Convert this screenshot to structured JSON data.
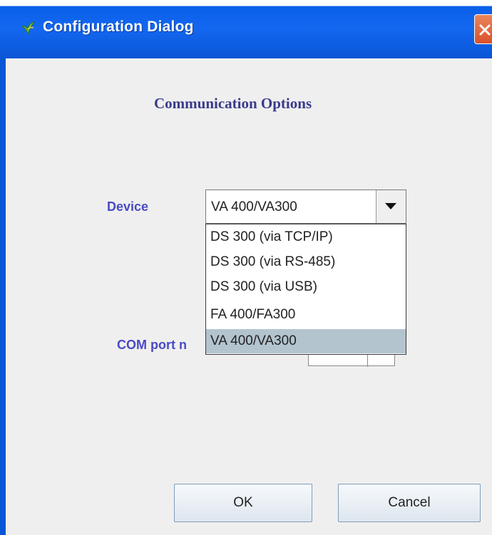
{
  "window": {
    "title": "Configuration Dialog",
    "app_icon": "leaf-icon",
    "close_icon": "close-icon"
  },
  "heading": "Communication Options",
  "device": {
    "label": "Device",
    "selected": "VA 400/VA300",
    "arrow_icon": "chevron-down-icon",
    "options": [
      "DS 300 (via TCP/IP)",
      "DS 300 (via RS-485)",
      "DS 300 (via USB)",
      "FA 400/FA300",
      "VA 400/VA300"
    ],
    "highlighted_index": 4
  },
  "com_port": {
    "label": "COM port n"
  },
  "buttons": {
    "ok": "OK",
    "cancel": "Cancel"
  },
  "colors": {
    "titlebar": "#0b56d6",
    "label_text": "#4a4ac4",
    "heading_text": "#3a3a8c",
    "selected_option": "#b3c4cf",
    "close_button": "#d9512b"
  }
}
